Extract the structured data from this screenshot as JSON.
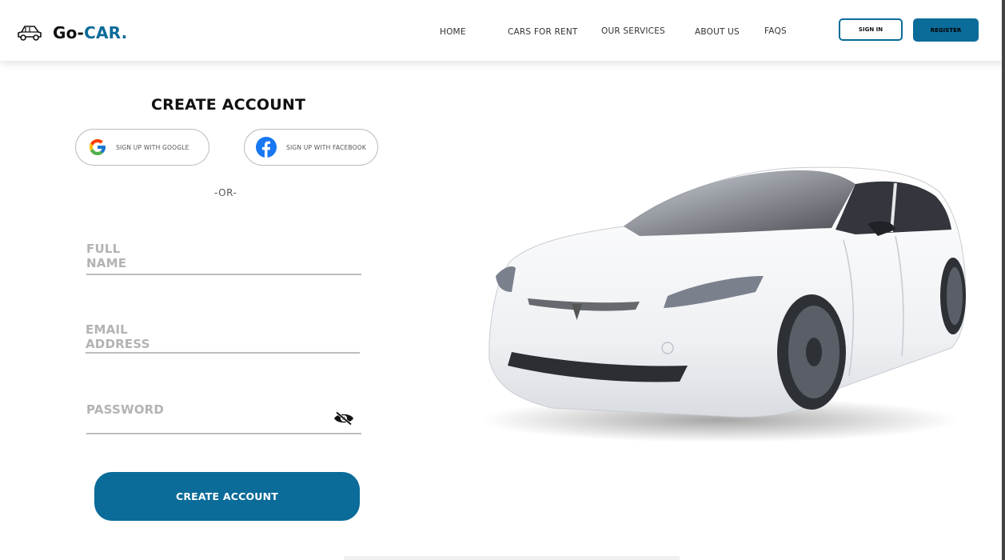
{
  "header": {
    "brand_prefix": "Go-",
    "brand_accent": "CAR.",
    "brand_icon": "car-outline-icon",
    "nav": [
      {
        "label": "HOME"
      },
      {
        "label": "CARS FOR RENT"
      },
      {
        "label": "OUR SERVICES"
      },
      {
        "label": "ABOUT US"
      },
      {
        "label": "FAQS"
      }
    ],
    "signin_label": "SIGN IN",
    "register_label": "REGISTER"
  },
  "form": {
    "title": "CREATE ACCOUNT",
    "google_label": "SIGN UP WITH GOOGLE",
    "facebook_label": "SIGN UP WITH FACEBOOK",
    "or_label": "-OR-",
    "full_name_placeholder": "FULL NAME",
    "email_placeholder": "EMAIL ADDRESS",
    "password_placeholder": "PASSWORD",
    "password_toggle_icon": "eye-off-icon",
    "submit_label": "CREATE ACCOUNT"
  },
  "hero": {
    "image": "white-sedan-car-image"
  },
  "colors": {
    "accent": "#0b6b99",
    "placeholder": "#b3b3b3",
    "divider": "#bdbdbd"
  }
}
